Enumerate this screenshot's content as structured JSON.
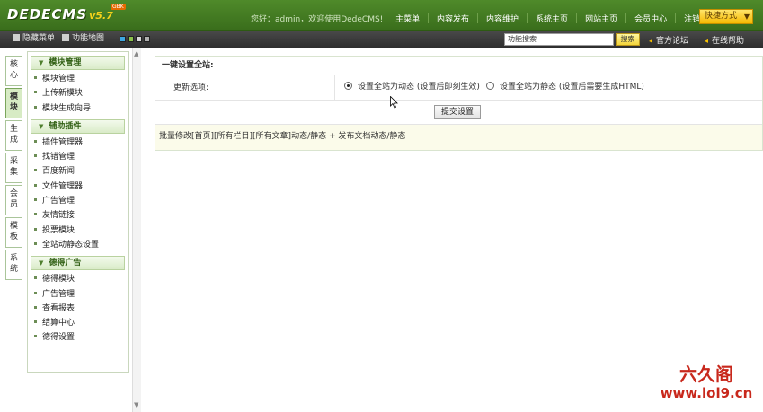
{
  "header": {
    "logo_text": "DEDECMS",
    "logo_version": "v5.7",
    "logo_badge": "GBK",
    "welcome": "您好：admin，欢迎使用DedeCMS!",
    "nav": [
      "主菜单",
      "内容发布",
      "内容维护",
      "系统主页",
      "网站主页",
      "会员中心",
      "注销"
    ],
    "quick_menu": "快捷方式"
  },
  "toolbar": {
    "hide_menu": "隐藏菜单",
    "function_map": "功能地图",
    "swatch_colors": [
      "#3da7e0",
      "#8bc34a",
      "#d8d8d8",
      "#b0b0b0"
    ],
    "search_value": "功能搜索",
    "search_button": "搜索",
    "forum_link": "官方论坛",
    "help_link": "在线帮助"
  },
  "vtabs": [
    {
      "label": "核心",
      "active": false
    },
    {
      "label": "模块",
      "active": true
    },
    {
      "label": "生成",
      "active": false
    },
    {
      "label": "采集",
      "active": false
    },
    {
      "label": "会员",
      "active": false
    },
    {
      "label": "模板",
      "active": false
    },
    {
      "label": "系统",
      "active": false
    }
  ],
  "sidemenu": [
    {
      "title": "模块管理",
      "items": [
        "模块管理",
        "上传新模块",
        "模块生成向导"
      ]
    },
    {
      "title": "辅助插件",
      "items": [
        "插件管理器",
        "找错管理",
        "百度新闻",
        "文件管理器",
        "广告管理",
        "友情链接",
        "投票模块",
        "全站动静态设置"
      ]
    },
    {
      "title": "德得广告",
      "items": [
        "德得模块",
        "广告管理",
        "查看报表",
        "结算中心",
        "德得设置"
      ]
    }
  ],
  "panel": {
    "title": "一键设置全站:",
    "option_label": "更新选项:",
    "radio_dynamic": "设置全站为动态 (设置后即刻生效)",
    "radio_static": "设置全站为静态 (设置后需要生成HTML)",
    "selected": "dynamic",
    "submit_label": "提交设置",
    "batch_text": "批量修改[首页][所有栏目][所有文章]动态/静态 + 发布文档动态/静态"
  },
  "watermark": {
    "brand": "六久阁",
    "url": "www.lol9.cn"
  }
}
